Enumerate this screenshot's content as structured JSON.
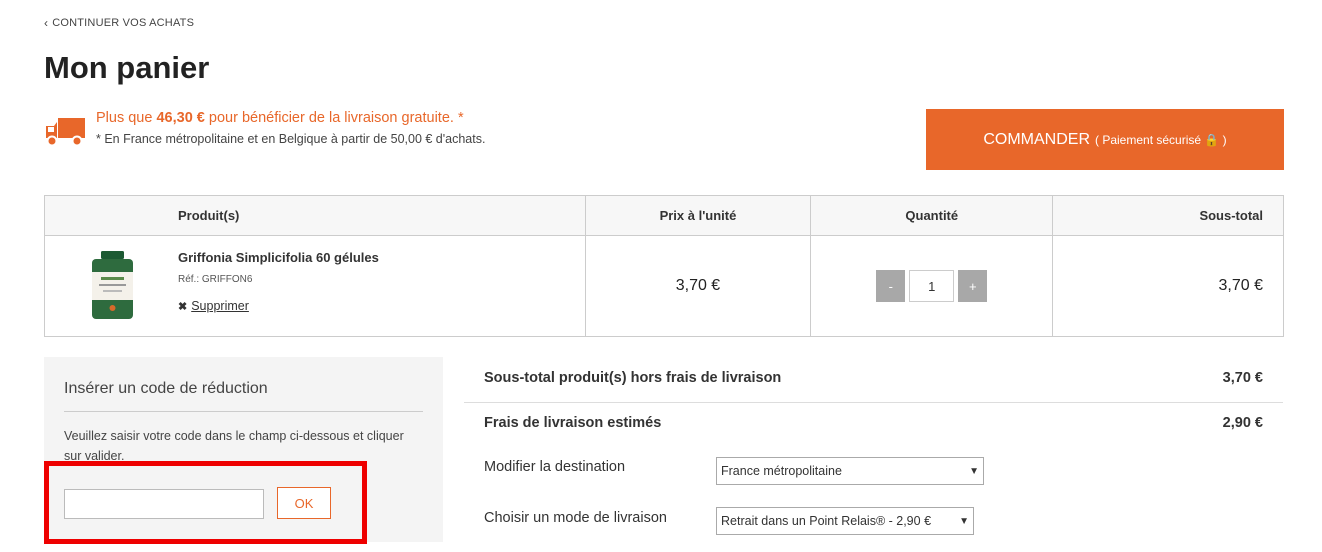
{
  "nav": {
    "back_label": "CONTINUER VOS ACHATS"
  },
  "page": {
    "title": "Mon panier"
  },
  "shipping": {
    "prefix": "Plus que ",
    "amount": "46,30 €",
    "suffix": " pour bénéficier de la livraison gratuite. *",
    "note": "* En France métropolitaine et en Belgique à partir de 50,00 € d'achats."
  },
  "checkout": {
    "label": "COMMANDER",
    "sub_label": "( Paiement sécurisé 🔒 )"
  },
  "cart": {
    "headers": {
      "product": "Produit(s)",
      "unit_price": "Prix à l'unité",
      "quantity": "Quantité",
      "subtotal": "Sous-total"
    },
    "items": [
      {
        "name": "Griffonia Simplicifolia 60 gélules",
        "ref": "Réf.: GRIFFON6",
        "remove_label": "Supprimer",
        "unit_price": "3,70 €",
        "quantity": "1",
        "subtotal": "3,70 €",
        "minus_label": "-",
        "plus_label": "+"
      }
    ]
  },
  "promo": {
    "title": "Insérer un code de réduction",
    "description": "Veuillez saisir votre code dans le champ ci-dessous et cliquer sur valider.",
    "input_value": "",
    "ok_label": "OK"
  },
  "summary": {
    "subtotal_label": "Sous-total produit(s) hors frais de livraison",
    "subtotal_value": "3,70 €",
    "shipping_label": "Frais de livraison estimés",
    "shipping_value": "2,90 €",
    "destination_label": "Modifier la destination",
    "destination_value": "France métropolitaine",
    "mode_label": "Choisir un mode de livraison",
    "mode_value": "Retrait dans un Point Relais® - 2,90 €"
  },
  "colors": {
    "accent": "#e8672a",
    "highlight": "#ee0000"
  }
}
